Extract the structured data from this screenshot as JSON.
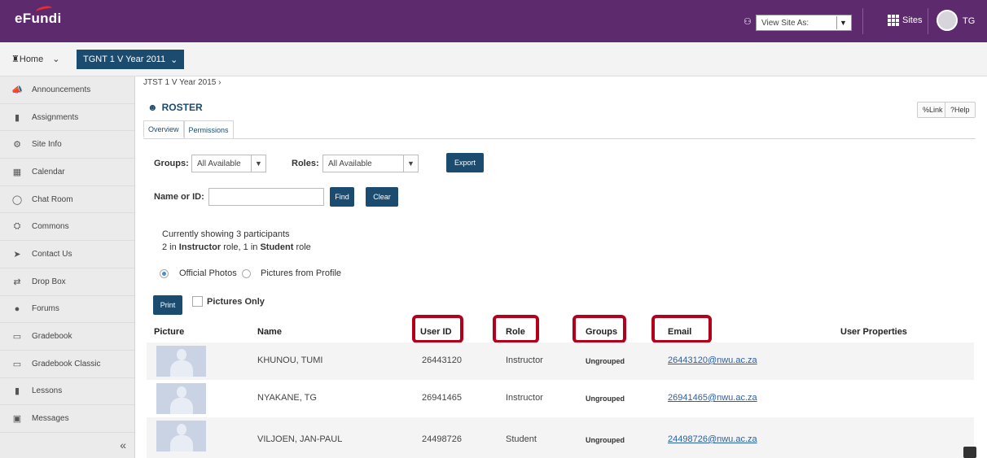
{
  "header": {
    "logo": "eFundi",
    "view_site_as": "View Site As:",
    "sites_label": "Sites",
    "user_initials": "TG"
  },
  "sitenav": {
    "home": "Home",
    "current_site": "TGNT 1 V Year 2011"
  },
  "sidebar": {
    "items": [
      {
        "label": "Announcements",
        "icon": "megaphone-icon"
      },
      {
        "label": "Assignments",
        "icon": "file-icon"
      },
      {
        "label": "Site Info",
        "icon": "gear-icon"
      },
      {
        "label": "Calendar",
        "icon": "calendar-icon"
      },
      {
        "label": "Chat Room",
        "icon": "chat-icon"
      },
      {
        "label": "Commons",
        "icon": "bank-icon"
      },
      {
        "label": "Contact Us",
        "icon": "send-icon"
      },
      {
        "label": "Drop Box",
        "icon": "exchange-icon"
      },
      {
        "label": "Forums",
        "icon": "comments-icon"
      },
      {
        "label": "Gradebook",
        "icon": "book-icon"
      },
      {
        "label": "Gradebook Classic",
        "icon": "book-icon"
      },
      {
        "label": "Lessons",
        "icon": "lessons-icon"
      },
      {
        "label": "Messages",
        "icon": "inbox-icon"
      }
    ],
    "collapse": "«"
  },
  "main": {
    "breadcrumb": "JTST 1 V Year 2015",
    "title": "ROSTER",
    "link_btn": "Link",
    "help_btn": "Help",
    "tabs": [
      "Overview",
      "Permissions"
    ],
    "groups_label": "Groups:",
    "groups_value": "All Available",
    "roles_label": "Roles:",
    "roles_value": "All Available",
    "export": "Export",
    "name_label": "Name or ID:",
    "find": "Find",
    "clear": "Clear",
    "showing": "Currently showing 3 participants",
    "counts_prefix": "2 in ",
    "counts_role1": "Instructor",
    "counts_mid": " role, 1 in ",
    "counts_role2": "Student",
    "counts_suffix": " role",
    "photo_opt1": "Official Photos",
    "photo_opt2": "Pictures from Profile",
    "print": "Print",
    "pictures_only": "Pictures Only"
  },
  "table": {
    "headers": [
      "Picture",
      "Name",
      "User ID",
      "Role",
      "Groups",
      "Email",
      "User Properties"
    ],
    "rows": [
      {
        "name": "KHUNOU, TUMI",
        "user_id": "26443120",
        "role": "Instructor",
        "groups": "Ungrouped",
        "email": "26443120@nwu.ac.za"
      },
      {
        "name": "NYAKANE, TG",
        "user_id": "26941465",
        "role": "Instructor",
        "groups": "Ungrouped",
        "email": "26941465@nwu.ac.za"
      },
      {
        "name": "VILJOEN, JAN-PAUL",
        "user_id": "24498726",
        "role": "Student",
        "groups": "Ungrouped",
        "email": "24498726@nwu.ac.za"
      }
    ]
  },
  "colors": {
    "header_bg": "#5e2a6e",
    "primary_button": "#1b4b6e",
    "highlight_box": "#b3001b",
    "link": "#2a5ea8"
  }
}
